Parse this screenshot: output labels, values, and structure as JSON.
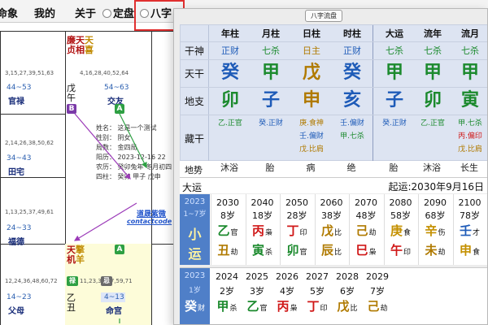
{
  "menu": {
    "item1": "命象",
    "item2": "我的",
    "item3": "关于",
    "radio1": "定盘",
    "radio2": "八字"
  },
  "bg_chart": {
    "palace_top": [
      {
        "text": "廉天",
        "text2": "天",
        "color": "#b01010",
        "color2": "#c08a00"
      },
      {
        "text": "贞相",
        "text2": "喜",
        "color": "#b01010",
        "color2": "#c08a00"
      },
      {
        "text": "天",
        "text2": "擎",
        "color": "#b01010",
        "color2": "#c08a00"
      },
      {
        "text": "机",
        "text2": "羊",
        "color": "#b01010",
        "color2": "#c08a00"
      }
    ],
    "ganzhi_small": [
      "3,15,27,39,51,63",
      "4,16,28,40,52,64",
      "2,14,26,38,50,62",
      "1,13,25,37,49,61",
      "12,24,36,48,60,72",
      "11,23,35,47,59,71"
    ],
    "ages": [
      "44~53",
      "54~63",
      "34~43",
      "24~33",
      "14~23",
      "4~13"
    ],
    "palace_names": [
      "官禄",
      "交友",
      "田宅",
      "福德",
      "父母",
      "命宫"
    ],
    "ganzhi_big": [
      {
        "a": "戊",
        "b": "午"
      },
      {
        "a": "乙",
        "b": "丑"
      }
    ],
    "badges": [
      "B",
      "A",
      "A",
      "禄",
      "忌"
    ],
    "info": [
      "姓名：  这是一个测试",
      "性别：  阴女",
      "局数：  金四局",
      "阳历：  2023-12-16  22",
      "农历：  癸卯兔年  冬月初四",
      "四柱：  癸卯  甲子  戊申"
    ],
    "contact_title": "道晟紫微",
    "contact_sub": "contactcode"
  },
  "dialog": {
    "title": "八字流盘",
    "headers": [
      "年柱",
      "月柱",
      "日柱",
      "时柱",
      "大运",
      "流年",
      "流月"
    ],
    "row_labels": {
      "shishen": "干神",
      "tiangan": "天干",
      "dizhi": "地支",
      "canggan": "藏干",
      "dishi": "地势"
    },
    "shishen": [
      {
        "t": "正财",
        "c": "#1e5bb8"
      },
      {
        "t": "七杀",
        "c": "#1c8a2e"
      },
      {
        "t": "日主",
        "c": "#b07a00"
      },
      {
        "t": "正财",
        "c": "#1e5bb8"
      },
      {
        "t": "七杀",
        "c": "#1c8a2e"
      },
      {
        "t": "七杀",
        "c": "#1c8a2e"
      },
      {
        "t": "七杀",
        "c": "#1c8a2e"
      }
    ],
    "tiangan": [
      {
        "t": "癸",
        "c": "#1e5bb8"
      },
      {
        "t": "甲",
        "c": "#1c8a2e"
      },
      {
        "t": "戊",
        "c": "#b07a00"
      },
      {
        "t": "癸",
        "c": "#1e5bb8"
      },
      {
        "t": "甲",
        "c": "#1c8a2e"
      },
      {
        "t": "甲",
        "c": "#1c8a2e"
      },
      {
        "t": "甲",
        "c": "#1c8a2e"
      }
    ],
    "dizhi": [
      {
        "t": "卯",
        "c": "#1c8a2e"
      },
      {
        "t": "子",
        "c": "#1e5bb8"
      },
      {
        "t": "申",
        "c": "#b07a00"
      },
      {
        "t": "亥",
        "c": "#1e5bb8"
      },
      {
        "t": "子",
        "c": "#1e5bb8"
      },
      {
        "t": "卯",
        "c": "#1c8a2e"
      },
      {
        "t": "寅",
        "c": "#1c8a2e"
      }
    ],
    "canggan": [
      [
        {
          "t": "乙.正官",
          "c": "#1c8a2e"
        }
      ],
      [
        {
          "t": "癸.正财",
          "c": "#1e5bb8"
        }
      ],
      [
        {
          "t": "庚.食神",
          "c": "#b07a00"
        },
        {
          "t": "壬.偏财",
          "c": "#1e5bb8"
        },
        {
          "t": "戊.比肩",
          "c": "#b07a00"
        }
      ],
      [
        {
          "t": "壬.偏财",
          "c": "#1e5bb8"
        },
        {
          "t": "甲.七杀",
          "c": "#1c8a2e"
        }
      ],
      [
        {
          "t": "癸.正财",
          "c": "#1e5bb8"
        }
      ],
      [
        {
          "t": "乙.正官",
          "c": "#1c8a2e"
        }
      ],
      [
        {
          "t": "甲.七杀",
          "c": "#1c8a2e"
        },
        {
          "t": "丙.偏印",
          "c": "#d01818"
        },
        {
          "t": "戊.比肩",
          "c": "#b07a00"
        }
      ]
    ],
    "dishi": [
      "沐浴",
      "胎",
      "病",
      "绝",
      "胎",
      "沐浴",
      "长生"
    ],
    "dayun_label": "大运",
    "qiyun": "起运:2030年9月16日",
    "dayun_first": {
      "year": "2023",
      "age": "1~7岁",
      "top": "小",
      "bottom": "运"
    },
    "dayun": [
      {
        "year": "2030",
        "age": "8岁",
        "g": "乙",
        "gc": "#1c8a2e",
        "gs": "官",
        "z": "丑",
        "zc": "#b07a00",
        "zs": "劫"
      },
      {
        "year": "2040",
        "age": "18岁",
        "g": "丙",
        "gc": "#d01818",
        "gs": "枭",
        "z": "寅",
        "zc": "#1c8a2e",
        "zs": "杀"
      },
      {
        "year": "2050",
        "age": "28岁",
        "g": "丁",
        "gc": "#d01818",
        "gs": "印",
        "z": "卯",
        "zc": "#1c8a2e",
        "zs": "官"
      },
      {
        "year": "2060",
        "age": "38岁",
        "g": "戊",
        "gc": "#b07a00",
        "gs": "比",
        "z": "辰",
        "zc": "#b07a00",
        "zs": "比"
      },
      {
        "year": "2070",
        "age": "48岁",
        "g": "己",
        "gc": "#b07a00",
        "gs": "劫",
        "z": "巳",
        "zc": "#d01818",
        "zs": "枭"
      },
      {
        "year": "2080",
        "age": "58岁",
        "g": "庚",
        "gc": "#c49000",
        "gs": "食",
        "z": "午",
        "zc": "#d01818",
        "zs": "印"
      },
      {
        "year": "2090",
        "age": "68岁",
        "g": "辛",
        "gc": "#c49000",
        "gs": "伤",
        "z": "未",
        "zc": "#b07a00",
        "zs": "劫"
      },
      {
        "year": "2100",
        "age": "78岁",
        "g": "壬",
        "gc": "#1e5bb8",
        "gs": "才",
        "z": "申",
        "zc": "#c49000",
        "zs": "食"
      }
    ],
    "liunian_first": {
      "year": "2023",
      "age": "1岁",
      "g": "癸",
      "gs": "财"
    },
    "liunian": [
      {
        "year": "2024",
        "age": "2岁",
        "g": "甲",
        "gc": "#1c8a2e",
        "gs": "杀"
      },
      {
        "year": "2025",
        "age": "3岁",
        "g": "乙",
        "gc": "#1c8a2e",
        "gs": "官"
      },
      {
        "year": "2026",
        "age": "4岁",
        "g": "丙",
        "gc": "#d01818",
        "gs": "枭"
      },
      {
        "year": "2027",
        "age": "5岁",
        "g": "丁",
        "gc": "#d01818",
        "gs": "印"
      },
      {
        "year": "2028",
        "age": "6岁",
        "g": "戊",
        "gc": "#b07a00",
        "gs": "比"
      },
      {
        "year": "2029",
        "age": "7岁",
        "g": "己",
        "gc": "#b07a00",
        "gs": "劫"
      }
    ]
  }
}
